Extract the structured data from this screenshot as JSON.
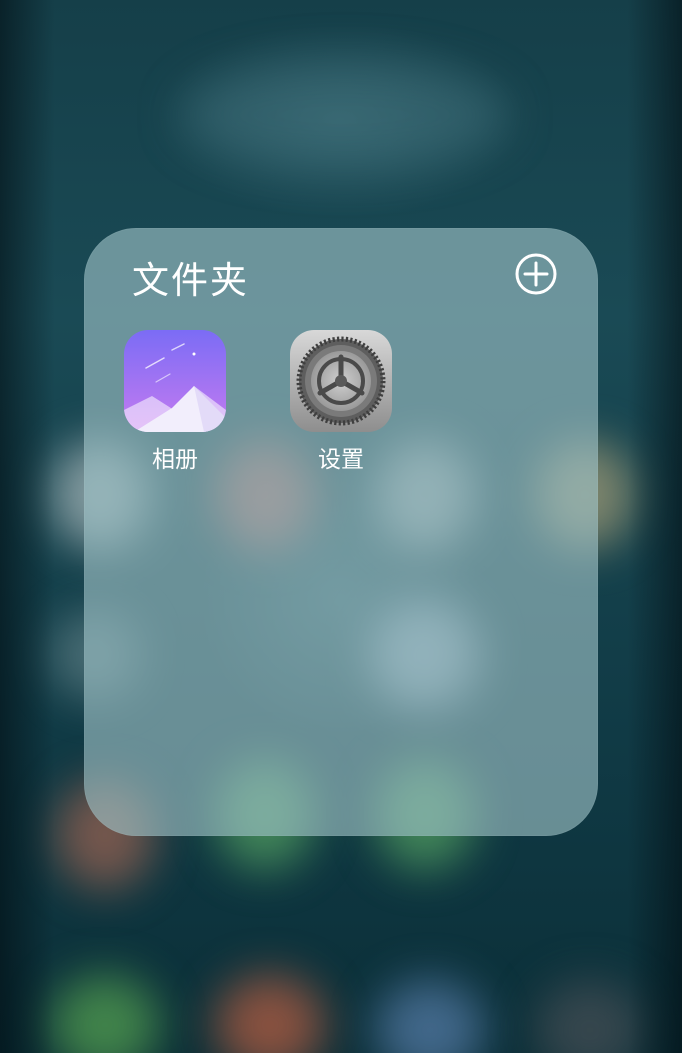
{
  "folder": {
    "title": "文件夹",
    "add_icon": "plus-circle-icon",
    "apps": [
      {
        "label": "相册",
        "icon": "gallery-icon",
        "colors": [
          "#7b6cf5",
          "#c67bf0"
        ]
      },
      {
        "label": "设置",
        "icon": "settings-gear-icon",
        "colors": [
          "#d8d8d8",
          "#8e8e8e"
        ]
      }
    ]
  },
  "theme": {
    "wallpaper": "#0f3a44",
    "folder_bg": "rgba(160,195,200,0.62)",
    "text": "#ffffff"
  }
}
